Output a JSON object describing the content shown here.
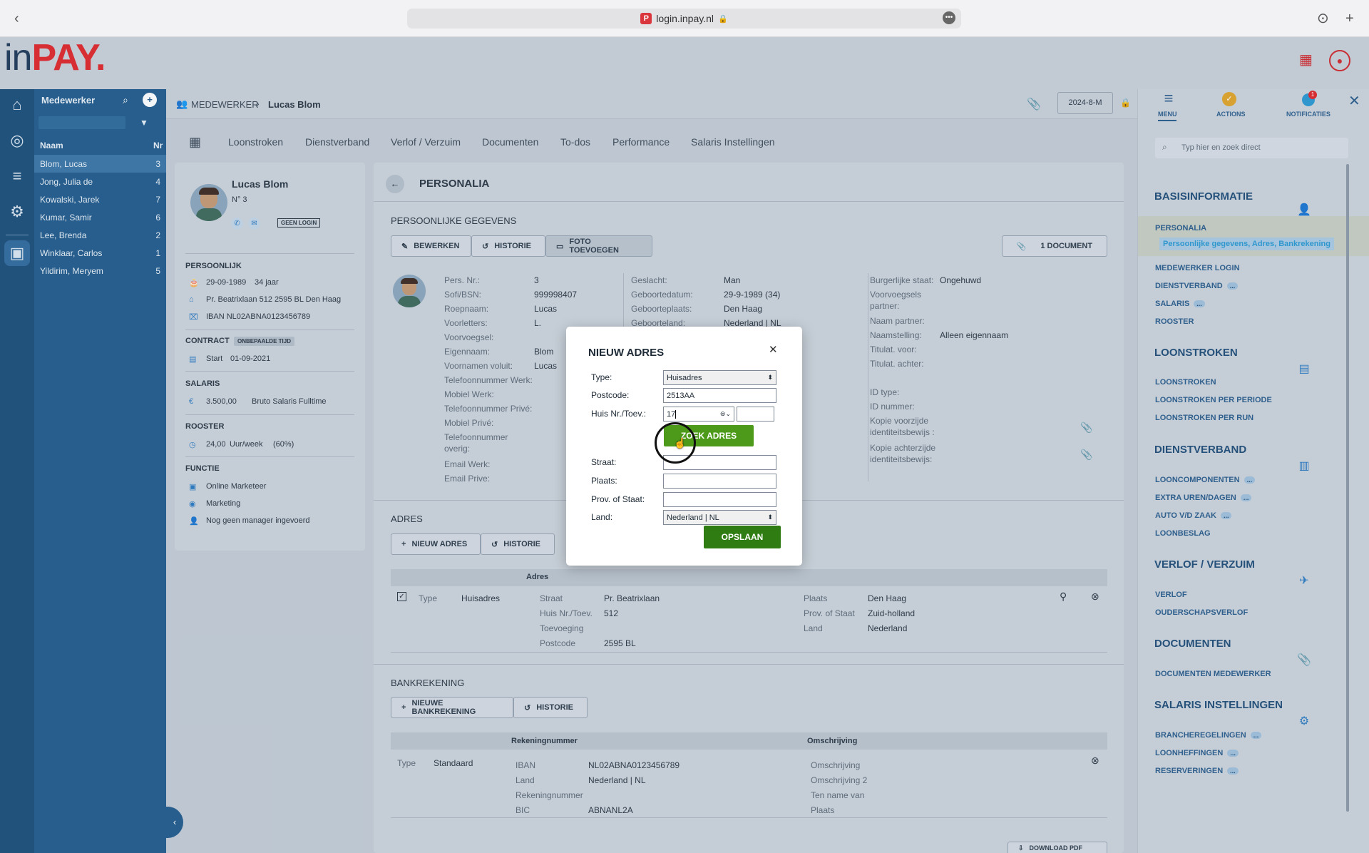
{
  "browser": {
    "url": "login.inpay.nl",
    "favicon": "P"
  },
  "logo": {
    "in": "in",
    "pay": "PAY",
    "dot": "."
  },
  "employees": {
    "header": "Medewerker",
    "col_name": "Naam",
    "col_nr": "Nr",
    "rows": [
      {
        "name": "Blom, Lucas",
        "nr": "3"
      },
      {
        "name": "Jong, Julia de",
        "nr": "4"
      },
      {
        "name": "Kowalski, Jarek",
        "nr": "7"
      },
      {
        "name": "Kumar, Samir",
        "nr": "6"
      },
      {
        "name": "Lee, Brenda",
        "nr": "2"
      },
      {
        "name": "Winklaar, Carlos",
        "nr": "1"
      },
      {
        "name": "Yildirim, Meryem",
        "nr": "5"
      }
    ]
  },
  "breadcrumb": {
    "section": "MEDEWERKER",
    "name": "Lucas Blom"
  },
  "period": "2024-8-M",
  "tabs": [
    "Loonstroken",
    "Dienstverband",
    "Verlof / Verzuim",
    "Documenten",
    "To-dos",
    "Performance",
    "Salaris Instellingen"
  ],
  "profile": {
    "name": "Lucas Blom",
    "nr": "N° 3",
    "no_login": "GEEN LOGIN",
    "persoonlijk_h": "PERSOONLIJK",
    "dob": "29-09-1989",
    "age": "34 jaar",
    "address": "Pr. Beatrixlaan 512 2595 BL Den Haag",
    "iban": "IBAN NL02ABNA0123456789",
    "contract_h": "CONTRACT",
    "contract_badge": "ONBEPAALDE TIJD",
    "start_lbl": "Start",
    "start": "01-09-2021",
    "salaris_h": "SALARIS",
    "salaris": "3.500,00",
    "salaris_desc": "Bruto Salaris Fulltime",
    "rooster_h": "ROOSTER",
    "rooster": "24,00",
    "rooster_unit": "Uur/week",
    "rooster_pct": "(60%)",
    "functie_h": "FUNCTIE",
    "functie": "Online Marketeer",
    "afdeling": "Marketing",
    "manager": "Nog geen manager ingevoerd"
  },
  "personalia": {
    "title": "PERSONALIA",
    "section": "PERSOONLIJKE GEGEVENS",
    "btn_edit": "BEWERKEN",
    "btn_hist": "HISTORIE",
    "btn_photo": "FOTO TOEVOEGEN",
    "btn_doc": "1 DOCUMENT",
    "col1": [
      [
        "Pers. Nr.:",
        "3"
      ],
      [
        "Sofi/BSN:",
        "999998407"
      ],
      [
        "Roepnaam:",
        "Lucas"
      ],
      [
        "Voorletters:",
        "L."
      ],
      [
        "Voorvoegsel:",
        ""
      ],
      [
        "Eigennaam:",
        "Blom"
      ],
      [
        "Voornamen voluit:",
        "Lucas"
      ],
      [
        "Telefoonnummer Werk:",
        ""
      ],
      [
        "Mobiel Werk:",
        ""
      ],
      [
        "Telefoonnummer Privé:",
        ""
      ],
      [
        "Mobiel Privé:",
        ""
      ]
    ],
    "tel_overig_1": "Telefoonnummer",
    "tel_overig_2": "overig:",
    "email_werk": "Email Werk:",
    "email_prive": "Email Prive:",
    "col2": [
      [
        "Geslacht:",
        "Man"
      ],
      [
        "Geboortedatum:",
        "29-9-1989 (34)"
      ],
      [
        "Geboorteplaats:",
        "Den Haag"
      ],
      [
        "Geboorteland:",
        "Nederland | NL"
      ]
    ],
    "col3": {
      "burg": "Burgerlijke staat:",
      "burg_v": "Ongehuwd",
      "vv_partner_1": "Voorvoegsels",
      "vv_partner_2": "partner:",
      "naam_partner": "Naam partner:",
      "naamstelling": "Naamstelling:",
      "naamstelling_v": "Alleen eigennaam",
      "titul_voor": "Titulat. voor:",
      "titul_achter": "Titulat. achter:",
      "id_type": "ID type:",
      "id_nummer": "ID nummer:",
      "kopie_voor_1": "Kopie voorzijde",
      "kopie_voor_2": "identiteitsbewijs :",
      "kopie_achter_1": "Kopie achterzijde",
      "kopie_achter_2": "identiteitsbewijs:"
    }
  },
  "adres": {
    "title": "ADRES",
    "btn_new": "NIEUW ADRES",
    "btn_hist": "HISTORIE",
    "table_h": "Adres",
    "type_lbl": "Type",
    "type": "Huisadres",
    "straat_lbl": "Straat",
    "straat": "Pr. Beatrixlaan",
    "huisnr_lbl": "Huis Nr./Toev.",
    "huisnr": "512",
    "toev_lbl": "Toevoeging",
    "postcode_lbl": "Postcode",
    "postcode": "2595 BL",
    "plaats_lbl": "Plaats",
    "plaats": "Den Haag",
    "prov_lbl": "Prov. of Staat",
    "prov": "Zuid-holland",
    "land_lbl": "Land",
    "land": "Nederland"
  },
  "bank": {
    "title": "BANKREKENING",
    "btn_new": "NIEUWE BANKREKENING",
    "btn_hist": "HISTORIE",
    "h_rek": "Rekeningnummer",
    "h_oms": "Omschrijving",
    "type_lbl": "Type",
    "type": "Standaard",
    "iban_lbl": "IBAN",
    "iban": "NL02ABNA0123456789",
    "land_lbl": "Land",
    "land": "Nederland | NL",
    "rek_lbl": "Rekeningnummer",
    "bic_lbl": "BIC",
    "bic": "ABNANL2A",
    "oms1": "Omschrijving",
    "oms2": "Omschrijving 2",
    "tnv": "Ten name van",
    "plaats": "Plaats",
    "download": "DOWNLOAD PDF"
  },
  "rmenu": {
    "tab_menu": "MENU",
    "tab_actions": "ACTIONS",
    "tab_notif": "NOTIFICATIES",
    "notif_count": "1",
    "search_placeholder": "Typ hier en zoek direct",
    "basis": "BASISINFORMATIE",
    "personalia": "PERSONALIA",
    "personalia_sub": "Persoonlijke gegevens, Adres, Bankrekening",
    "basis_items": [
      "MEDEWERKER LOGIN",
      "DIENSTVERBAND",
      "SALARIS",
      "ROOSTER"
    ],
    "loonstroken": "LOONSTROKEN",
    "loon_items": [
      "LOONSTROKEN",
      "LOONSTROKEN PER PERIODE",
      "LOONSTROKEN PER RUN"
    ],
    "dienstverband": "DIENSTVERBAND",
    "dienst_items": [
      "LOONCOMPONENTEN",
      "EXTRA UREN/DAGEN",
      "AUTO V/D ZAAK",
      "LOONBESLAG"
    ],
    "verlof": "VERLOF / VERZUIM",
    "verlof_items": [
      "VERLOF",
      "OUDERSCHAPSVERLOF"
    ],
    "documenten": "DOCUMENTEN",
    "doc_items": [
      "DOCUMENTEN MEDEWERKER"
    ],
    "salaris": "SALARIS INSTELLINGEN",
    "sal_items": [
      "BRANCHEREGELINGEN",
      "LOONHEFFINGEN",
      "RESERVERINGEN"
    ],
    "dots": "..."
  },
  "modal": {
    "title": "NIEUW ADRES",
    "type_lbl": "Type:",
    "type_val": "Huisadres",
    "postcode_lbl": "Postcode:",
    "postcode_val": "2513AA",
    "huisnr_lbl": "Huis Nr./Toev.:",
    "huisnr_val": "17",
    "zoek": "ZOEK ADRES",
    "straat_lbl": "Straat:",
    "plaats_lbl": "Plaats:",
    "prov_lbl": "Prov. of Staat:",
    "land_lbl": "Land:",
    "land_val": "Nederland | NL",
    "save": "OPSLAAN"
  }
}
